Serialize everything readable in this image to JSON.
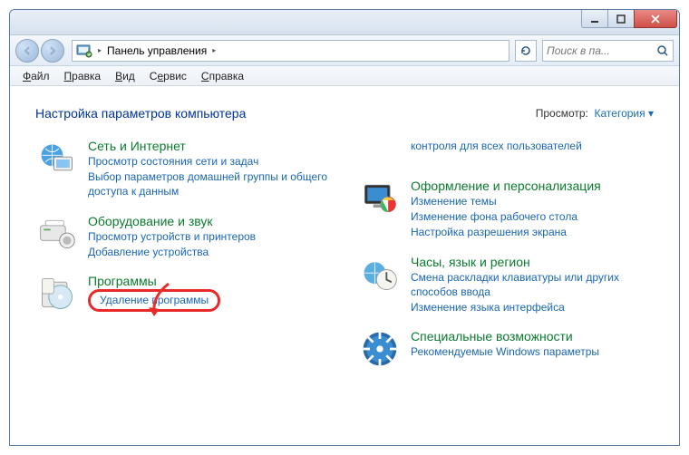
{
  "breadcrumb": {
    "label": "Панель управления"
  },
  "search": {
    "placeholder": "Поиск в па..."
  },
  "menu": {
    "file": "Файл",
    "edit": "Правка",
    "view": "Вид",
    "tools": "Сервис",
    "help": "Справка"
  },
  "header": {
    "title": "Настройка параметров компьютера",
    "view_label": "Просмотр:",
    "view_value": "Категория"
  },
  "left": [
    {
      "title": "Сеть и Интернет",
      "links": [
        "Просмотр состояния сети и задач",
        "Выбор параметров домашней группы и общего доступа к данным"
      ]
    },
    {
      "title": "Оборудование и звук",
      "links": [
        "Просмотр устройств и принтеров",
        "Добавление устройства"
      ]
    },
    {
      "title": "Программы",
      "links": [
        "Удаление программы"
      ]
    }
  ],
  "right_orphan": "контроля для всех пользователей",
  "right": [
    {
      "title": "Оформление и персонализация",
      "links": [
        "Изменение темы",
        "Изменение фона рабочего стола",
        "Настройка разрешения экрана"
      ]
    },
    {
      "title": "Часы, язык и регион",
      "links": [
        "Смена раскладки клавиатуры или других способов ввода",
        "Изменение языка интерфейса"
      ]
    },
    {
      "title": "Специальные возможности",
      "links": [
        "Рекомендуемые Windows параметры"
      ]
    }
  ]
}
